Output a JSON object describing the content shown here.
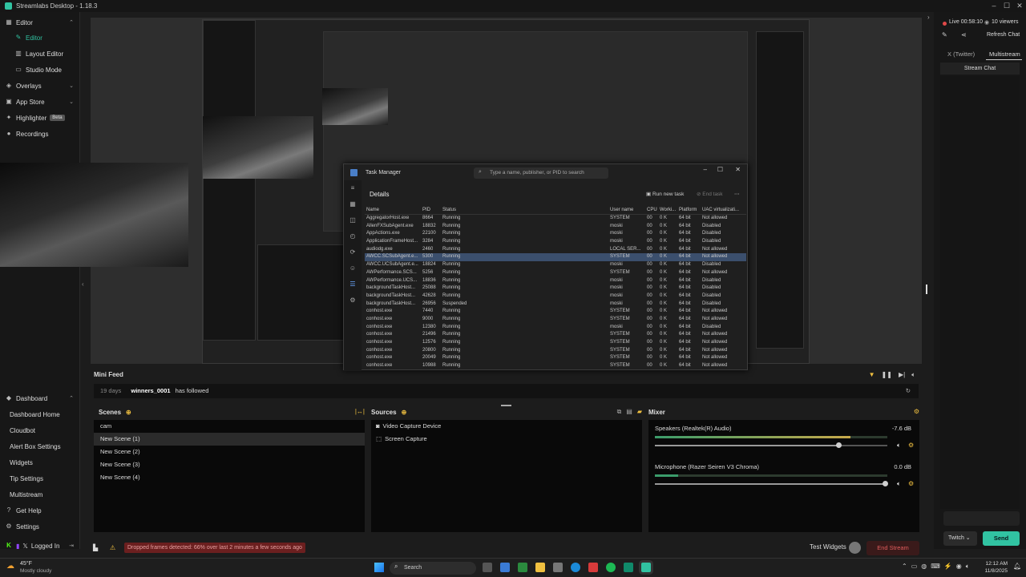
{
  "app": {
    "title": "Streamlabs Desktop - 1.18.3"
  },
  "sidebar": {
    "items": [
      {
        "label": "Editor"
      },
      {
        "label": "Editor"
      },
      {
        "label": "Layout Editor"
      },
      {
        "label": "Studio Mode"
      },
      {
        "label": "Overlays"
      },
      {
        "label": "App Store"
      },
      {
        "label": "Highlighter",
        "badge": "Beta"
      },
      {
        "label": "Recordings"
      },
      {
        "label": "Dashboard"
      },
      {
        "label": "Dashboard Home"
      },
      {
        "label": "Cloudbot"
      },
      {
        "label": "Alert Box Settings"
      },
      {
        "label": "Widgets"
      },
      {
        "label": "Tip Settings"
      },
      {
        "label": "Multistream"
      },
      {
        "label": "Get Help"
      },
      {
        "label": "Settings"
      }
    ],
    "logged_in": "Logged In"
  },
  "task_manager": {
    "title": "Task Manager",
    "search_placeholder": "Type a name, publisher, or PID to search",
    "heading": "Details",
    "run_new_task": "Run new task",
    "end_task": "End task",
    "columns": [
      "Name",
      "PID",
      "Status",
      "User name",
      "CPU",
      "Worki...",
      "Platform",
      "UAC virtualizati..."
    ],
    "rows": [
      [
        "AggregatorHost.exe",
        "8664",
        "Running",
        "SYSTEM",
        "00",
        "0 K",
        "64 bit",
        "Not allowed"
      ],
      [
        "AllenFXSubAgent.exe",
        "18832",
        "Running",
        "moski",
        "00",
        "0 K",
        "64 bit",
        "Disabled"
      ],
      [
        "AppActions.exe",
        "22100",
        "Running",
        "moski",
        "00",
        "0 K",
        "64 bit",
        "Disabled"
      ],
      [
        "ApplicationFrameHost...",
        "3284",
        "Running",
        "moski",
        "00",
        "0 K",
        "64 bit",
        "Disabled"
      ],
      [
        "audiodg.exe",
        "2460",
        "Running",
        "LOCAL SER...",
        "00",
        "0 K",
        "64 bit",
        "Not allowed"
      ],
      [
        "AWCC.SCSubAgent.e...",
        "5300",
        "Running",
        "SYSTEM",
        "00",
        "0 K",
        "64 bit",
        "Not allowed"
      ],
      [
        "AWCC.UCSubAgent.e...",
        "18824",
        "Running",
        "moski",
        "00",
        "0 K",
        "64 bit",
        "Disabled"
      ],
      [
        "AWPerformance.SCS...",
        "5256",
        "Running",
        "SYSTEM",
        "00",
        "0 K",
        "64 bit",
        "Not allowed"
      ],
      [
        "AWPerformance.UCS...",
        "18836",
        "Running",
        "moski",
        "00",
        "0 K",
        "64 bit",
        "Disabled"
      ],
      [
        "backgroundTaskHost...",
        "25088",
        "Running",
        "moski",
        "00",
        "0 K",
        "64 bit",
        "Disabled"
      ],
      [
        "backgroundTaskHost...",
        "42628",
        "Running",
        "moski",
        "00",
        "0 K",
        "64 bit",
        "Disabled"
      ],
      [
        "backgroundTaskHost...",
        "26956",
        "Suspended",
        "moski",
        "00",
        "0 K",
        "64 bit",
        "Disabled"
      ],
      [
        "conhost.exe",
        "7440",
        "Running",
        "SYSTEM",
        "00",
        "0 K",
        "64 bit",
        "Not allowed"
      ],
      [
        "conhost.exe",
        "9000",
        "Running",
        "SYSTEM",
        "00",
        "0 K",
        "64 bit",
        "Not allowed"
      ],
      [
        "conhost.exe",
        "12380",
        "Running",
        "moski",
        "00",
        "0 K",
        "64 bit",
        "Disabled"
      ],
      [
        "conhost.exe",
        "21496",
        "Running",
        "SYSTEM",
        "00",
        "0 K",
        "64 bit",
        "Not allowed"
      ],
      [
        "conhost.exe",
        "12576",
        "Running",
        "SYSTEM",
        "00",
        "0 K",
        "64 bit",
        "Not allowed"
      ],
      [
        "conhost.exe",
        "20800",
        "Running",
        "SYSTEM",
        "00",
        "0 K",
        "64 bit",
        "Not allowed"
      ],
      [
        "conhost.exe",
        "20049",
        "Running",
        "SYSTEM",
        "00",
        "0 K",
        "64 bit",
        "Not allowed"
      ],
      [
        "conhost.exe",
        "10988",
        "Running",
        "SYSTEM",
        "00",
        "0 K",
        "64 bit",
        "Not allowed"
      ]
    ]
  },
  "mini_feed": {
    "title": "Mini Feed",
    "event": {
      "age": "19 days",
      "user": "winners_0001",
      "action": "has followed"
    }
  },
  "scenes": {
    "title": "Scenes",
    "items": [
      "cam",
      "New Scene (1)",
      "New Scene (2)",
      "New Scene (3)",
      "New Scene (4)"
    ],
    "active_index": 1
  },
  "sources": {
    "title": "Sources",
    "items": [
      "Video Capture Device",
      "Screen Capture"
    ]
  },
  "mixer": {
    "title": "Mixer",
    "channels": [
      {
        "name": "Speakers (Realtek(R) Audio)",
        "db": "-7.6 dB",
        "level": 0.84,
        "volume": 0.79
      },
      {
        "name": "Microphone (Razer Seiren V3 Chroma)",
        "db": "0.0 dB",
        "level": 0.1,
        "volume": 0.99
      }
    ]
  },
  "status": {
    "warning": "Dropped frames detected: 66% over last 2 minutes a few seconds ago",
    "test_widgets": "Test Widgets",
    "end_stream": "End Stream"
  },
  "chat": {
    "live": "Live 00:58:10",
    "viewers": "10 viewers",
    "refresh": "Refresh Chat",
    "tabs": [
      "X (Twitter)",
      "Multistream"
    ],
    "stream_chat": "Stream Chat",
    "platform": "Twitch",
    "send": "Send"
  },
  "taskbar": {
    "temp": "45°F",
    "weather": "Mostly cloudy",
    "search": "Search",
    "time": "12:12 AM",
    "date": "11/8/2025"
  },
  "colors": {
    "accent": "#31c3a2",
    "danger": "#d24242",
    "warning_bg": "#6b1f1f"
  }
}
